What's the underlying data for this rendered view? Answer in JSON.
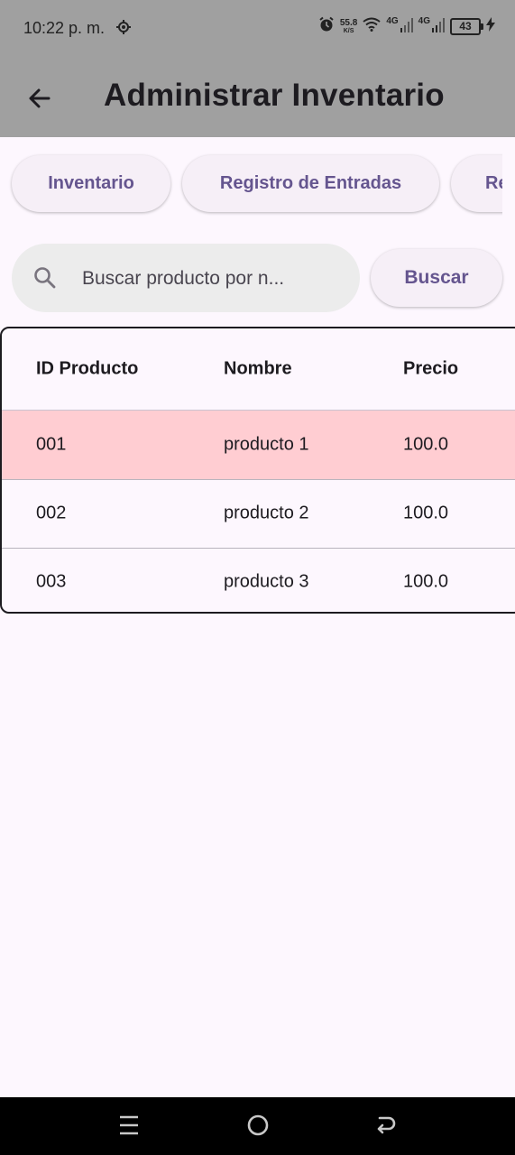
{
  "status_bar": {
    "time": "10:22 p. m.",
    "net_speed": "55.8",
    "net_unit": "K/S",
    "signal_1": "4G",
    "signal_2": "4G",
    "battery": "43"
  },
  "app_bar": {
    "title": "Administrar Inventario",
    "back_icon": "arrow-back-icon"
  },
  "chips": [
    "Inventario",
    "Registro de Entradas",
    "Re"
  ],
  "search": {
    "placeholder": "Buscar producto por n...",
    "value": "",
    "button_label": "Buscar",
    "icon": "search-icon"
  },
  "table": {
    "headers": [
      "ID Producto",
      "Nombre",
      "Precio"
    ],
    "rows": [
      {
        "id": "001",
        "name": "producto 1",
        "price": "100.0",
        "highlighted": true
      },
      {
        "id": "002",
        "name": "producto 2",
        "price": "100.0",
        "highlighted": false
      },
      {
        "id": "003",
        "name": "producto 3",
        "price": "100.0",
        "highlighted": false
      }
    ]
  },
  "colors": {
    "app_bar": "#a0a0a0",
    "accent": "#65558f",
    "highlight_row": "#ffcdd2",
    "background": "#fdf7fe"
  },
  "nav_bar": {
    "recents_icon": "menu-icon",
    "home_icon": "home-circle-icon",
    "back_icon": "back-icon"
  }
}
